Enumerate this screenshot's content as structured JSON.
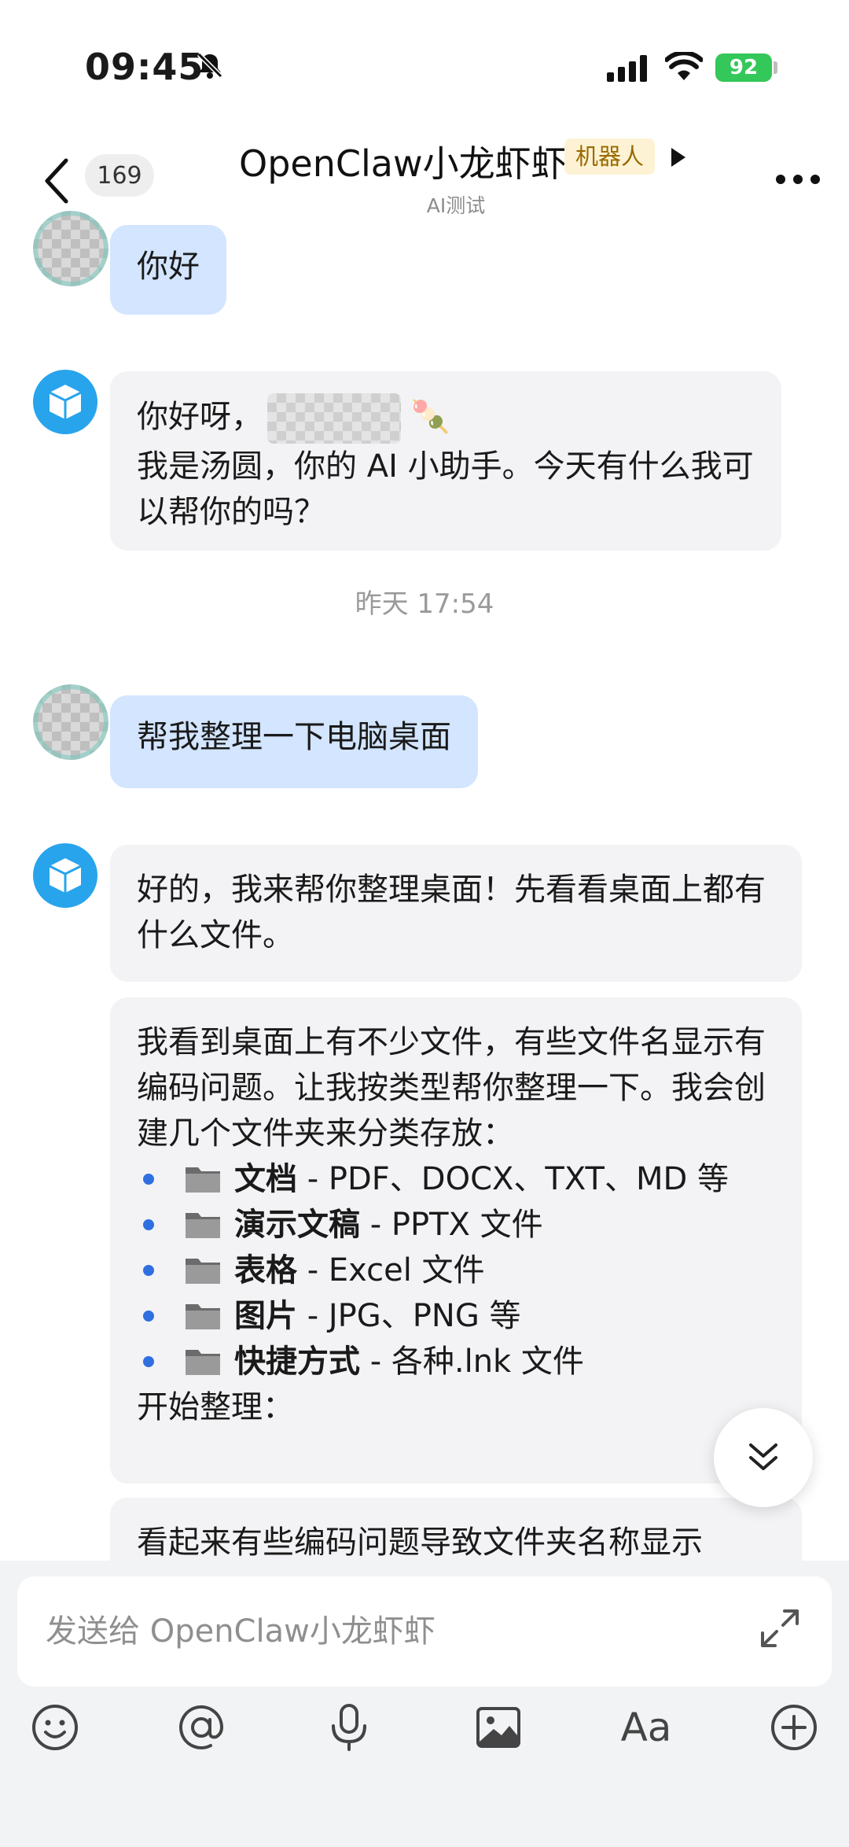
{
  "status_bar": {
    "time": "09:45",
    "battery": "92"
  },
  "header": {
    "unread_count": "169",
    "title": "OpenClaw小龙虾虾",
    "tag": "机器人",
    "subtitle": "AI测试"
  },
  "messages": {
    "m1_user": "你好",
    "m2_bot_line1": "你好呀，",
    "m2_bot_emoji": "🍡",
    "m2_bot_line2": "我是汤圆，你的 AI 小助手。今天有什么我可以帮你的吗？",
    "timestamp": "昨天 17:54",
    "m3_user": "帮我整理一下电脑桌面",
    "m4_bot": "好的，我来帮你整理桌面！先看看桌面上都有什么文件。",
    "m5_bot_intro": "我看到桌面上有不少文件，有些文件名显示有编码问题。让我按类型帮你整理一下。我会创建几个文件夹来分类存放：",
    "m5_folders": [
      {
        "name": "文档",
        "desc": " - PDF、DOCX、TXT、MD 等"
      },
      {
        "name": "演示文稿",
        "desc": " - PPTX 文件"
      },
      {
        "name": "表格",
        "desc": " - Excel 文件"
      },
      {
        "name": "图片",
        "desc": " - JPG、PNG 等"
      },
      {
        "name": "快捷方式",
        "desc": " - 各种.lnk 文件"
      }
    ],
    "m5_bot_outro": "开始整理：",
    "m6_bot_partial": "看起来有些编码问题导致文件夹名称显示"
  },
  "composer": {
    "placeholder": "发送给 OpenClaw小龙虾虾",
    "font_button": "Aa"
  },
  "colors": {
    "user_bubble": "#d3e5ff",
    "bot_bubble": "#f3f3f5",
    "bot_avatar": "#27a4ec",
    "bullet": "#2f6fe0",
    "battery": "#34c759"
  },
  "icons": [
    "bell-off-icon",
    "signal-icon",
    "wifi-icon",
    "back-icon",
    "play-icon",
    "more-icon",
    "cube-icon",
    "folder-icon",
    "scroll-down-icon",
    "expand-icon",
    "emoji-icon",
    "at-icon",
    "mic-icon",
    "image-icon",
    "font-icon",
    "plus-circle-icon"
  ]
}
